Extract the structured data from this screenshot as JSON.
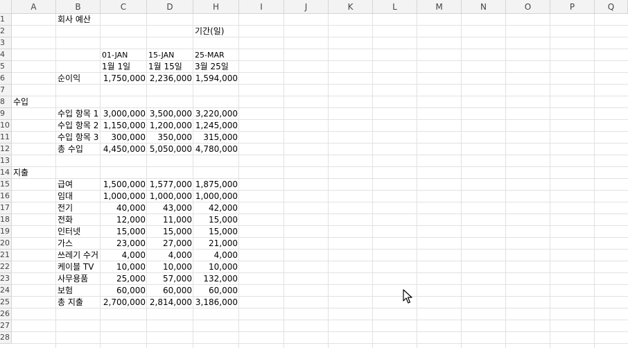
{
  "columns": [
    "A",
    "B",
    "C",
    "D",
    "H",
    "I",
    "J",
    "K",
    "L",
    "M",
    "N",
    "O",
    "P",
    "Q"
  ],
  "rows": [
    "1",
    "2",
    "3",
    "4",
    "5",
    "6",
    "7",
    "8",
    "9",
    "10",
    "11",
    "12",
    "13",
    "14",
    "15",
    "16",
    "17",
    "18",
    "19",
    "20",
    "21",
    "22",
    "23",
    "24",
    "25",
    "26",
    "27",
    "28"
  ],
  "cells": {
    "title": "회사 예산",
    "period_label": "기간(일)",
    "dates": {
      "c_code": "01-JAN",
      "d_code": "15-JAN",
      "h_code": "25-MAR",
      "c_kor": "1월 1일",
      "d_kor": "1월 15일",
      "h_kor": "3월 25일"
    },
    "net_income": {
      "label": "순이익",
      "c": "1,750,000",
      "d": "2,236,000",
      "h": "1,594,000"
    },
    "income_section": "수입",
    "income": [
      {
        "label": "수입 항목 1",
        "c": "3,000,000",
        "d": "3,500,000",
        "h": "3,220,000"
      },
      {
        "label": "수입 항목 2",
        "c": "1,150,000",
        "d": "1,200,000",
        "h": "1,245,000"
      },
      {
        "label": "수입 항목 3",
        "c": "300,000",
        "d": "350,000",
        "h": "315,000"
      },
      {
        "label": "총 수입",
        "c": "4,450,000",
        "d": "5,050,000",
        "h": "4,780,000"
      }
    ],
    "expense_section": "지출",
    "expenses": [
      {
        "label": "급여",
        "c": "1,500,000",
        "d": "1,577,000",
        "h": "1,875,000"
      },
      {
        "label": "임대",
        "c": "1,000,000",
        "d": "1,000,000",
        "h": "1,000,000"
      },
      {
        "label": "전기",
        "c": "40,000",
        "d": "43,000",
        "h": "42,000"
      },
      {
        "label": "전화",
        "c": "12,000",
        "d": "11,000",
        "h": "15,000"
      },
      {
        "label": "인터넷",
        "c": "15,000",
        "d": "15,000",
        "h": "15,000"
      },
      {
        "label": "가스",
        "c": "23,000",
        "d": "27,000",
        "h": "21,000"
      },
      {
        "label": "쓰레기 수거",
        "c": "4,000",
        "d": "4,000",
        "h": "4,000"
      },
      {
        "label": "케이블 TV",
        "c": "10,000",
        "d": "10,000",
        "h": "10,000"
      },
      {
        "label": "사무용품",
        "c": "25,000",
        "d": "57,000",
        "h": "132,000"
      },
      {
        "label": "보험",
        "c": "60,000",
        "d": "60,000",
        "h": "60,000"
      },
      {
        "label": "총 지출",
        "c": "2,700,000",
        "d": "2,814,000",
        "h": "3,186,000"
      }
    ]
  },
  "cursor_icon": "mouse-pointer-icon"
}
